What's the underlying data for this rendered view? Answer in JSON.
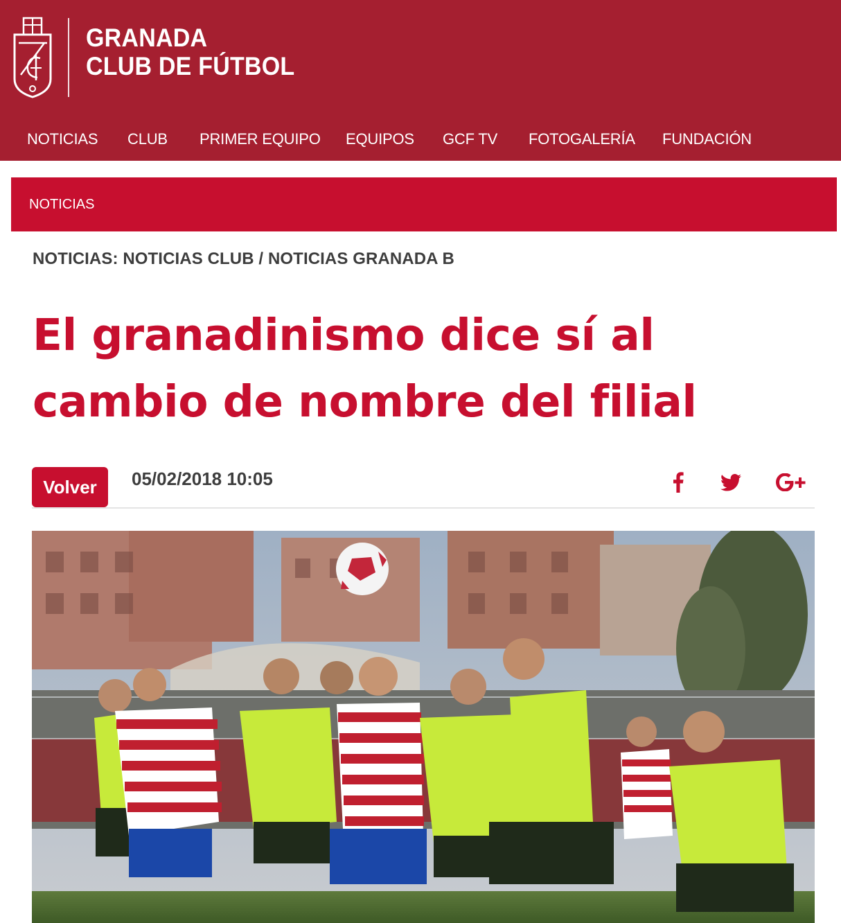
{
  "brand": {
    "line1": "GRANADA",
    "line2": "CLUB DE FÚTBOL",
    "color": "#a51f30"
  },
  "nav": {
    "items": [
      {
        "label": "NOTICIAS"
      },
      {
        "label": "CLUB"
      },
      {
        "label": "PRIMER EQUIPO"
      },
      {
        "label": "EQUIPOS"
      },
      {
        "label": "GCF TV"
      },
      {
        "label": "FOTOGALERÍA"
      },
      {
        "label": "FUNDACIÓN"
      }
    ]
  },
  "section": {
    "label": "NOTICIAS",
    "color": "#c70f2f"
  },
  "breadcrumb": {
    "prefix": "NOTICIAS:",
    "category1": "NOTICIAS CLUB",
    "separator": "/",
    "category2": "NOTICIAS GRANADA B"
  },
  "article": {
    "title": "El granadinismo dice sí al cambio de nombre del filial",
    "back_label": "Volver",
    "date": "05/02/2018 10:05"
  },
  "share": {
    "icons": [
      "facebook-icon",
      "twitter-icon",
      "google-plus-icon"
    ]
  },
  "image": {
    "subject": "football-match-photo"
  }
}
